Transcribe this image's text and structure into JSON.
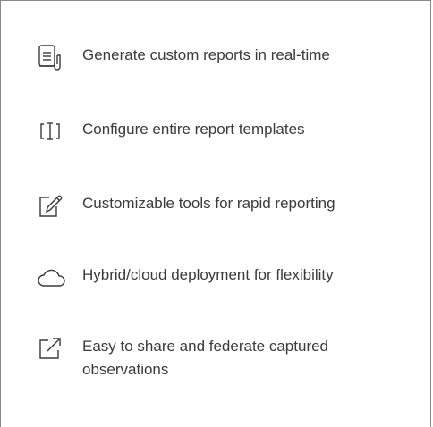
{
  "features": [
    {
      "icon": "report-document-icon",
      "text": "Generate custom reports in real-time"
    },
    {
      "icon": "text-cursor-bracket-icon",
      "text": "Configure entire report templates"
    },
    {
      "icon": "edit-pencil-icon",
      "text": "Customizable tools for rapid reporting"
    },
    {
      "icon": "cloud-icon",
      "text": "Hybrid/cloud deployment for flexibility"
    },
    {
      "icon": "share-external-link-icon",
      "text": "Easy to share and federate captured\nobservations"
    }
  ]
}
